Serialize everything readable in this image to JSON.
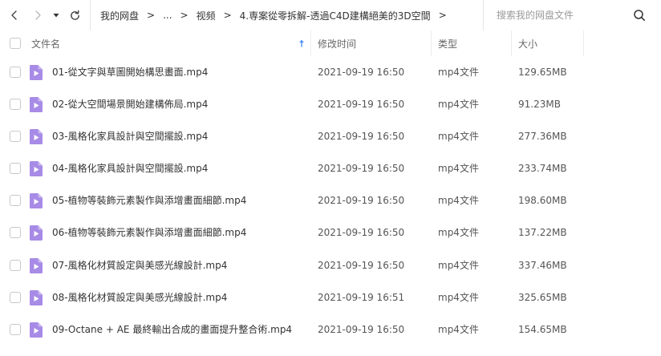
{
  "nav": {
    "back_icon": "chevron-left-icon",
    "forward_icon": "chevron-right-icon",
    "history_icon": "caret-down-icon",
    "refresh_icon": "refresh-icon"
  },
  "breadcrumb": {
    "items": [
      "我的网盘",
      "...",
      "视频",
      "4.専案從零拆解-透過C4D建構絕美的3D空間"
    ],
    "separator": ">"
  },
  "search": {
    "placeholder": "搜索我的网盘文件",
    "value": ""
  },
  "columns": {
    "name": "文件名",
    "time": "修改时间",
    "type": "类型",
    "size": "大小"
  },
  "files": [
    {
      "name": "01-從文字與草圖開始構思畫面.mp4",
      "time": "2021-09-19 16:50",
      "type": "mp4文件",
      "size": "129.65MB"
    },
    {
      "name": "02-從大空間場景開始建構佈局.mp4",
      "time": "2021-09-19 16:50",
      "type": "mp4文件",
      "size": "91.23MB"
    },
    {
      "name": "03-風格化家具設計與空間擺設.mp4",
      "time": "2021-09-19 16:50",
      "type": "mp4文件",
      "size": "277.36MB"
    },
    {
      "name": "04-風格化家具設計與空間擺設.mp4",
      "time": "2021-09-19 16:50",
      "type": "mp4文件",
      "size": "233.74MB"
    },
    {
      "name": "05-植物等裝飾元素製作與添增畫面細節.mp4",
      "time": "2021-09-19 16:50",
      "type": "mp4文件",
      "size": "198.60MB"
    },
    {
      "name": "06-植物等裝飾元素製作與添增畫面細節.mp4",
      "time": "2021-09-19 16:50",
      "type": "mp4文件",
      "size": "137.22MB"
    },
    {
      "name": "07-風格化材質設定與美感光線設計.mp4",
      "time": "2021-09-19 16:50",
      "type": "mp4文件",
      "size": "337.46MB"
    },
    {
      "name": "08-風格化材質設定與美感光線設計.mp4",
      "time": "2021-09-19 16:51",
      "type": "mp4文件",
      "size": "325.65MB"
    },
    {
      "name": "09-Octane + AE 最終輸出合成的畫面提升整合術.mp4",
      "time": "2021-09-19 16:50",
      "type": "mp4文件",
      "size": "154.65MB"
    }
  ],
  "colors": {
    "file_icon": "#a88be6",
    "file_icon_fold": "#c9b6f2",
    "sort_arrow": "#4e8cf7"
  }
}
